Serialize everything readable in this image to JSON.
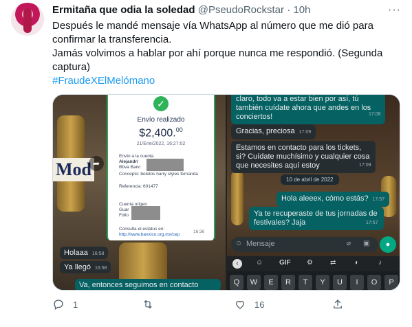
{
  "author": {
    "name": "Ermitaña que odia la soledad",
    "handle": "@PseudoRockstar",
    "separator": "·",
    "time": "10h"
  },
  "tweet": {
    "line1": "Después le mandé mensaje vía WhatsApp al número que me dió para confirmar la transferencia.",
    "line2": "Jamás volvimos a hablar por ahí porque nunca me respondió. (Segunda captura)",
    "hashtag": "#FraudeXElMelómano"
  },
  "media_left": {
    "receipt": {
      "title": "Envío realizado",
      "amount": "$2,400.",
      "amount_cents": "00",
      "date": "21/Ene/2022, 16:27:02",
      "sent_to_label": "Envío a la cuenta",
      "recipient": "Alejandri",
      "bank": "Bbva Banc",
      "concept": "Concepto: boletos harry styles fernanda",
      "reference": "Referencia: 601477",
      "origin_label": "Cuenta origen",
      "origin_line1": "Guar",
      "origin_line2": "Folio",
      "status_link_label": "Consulta el estatus en:",
      "status_link": "http://www.banxico.org.mx/cep",
      "time": "16:36"
    },
    "beer_label": "Mod",
    "messages": [
      {
        "text": "Holaaa",
        "time": "16:58"
      },
      {
        "text": "Ya llegó",
        "time": "16:58"
      },
      {
        "text": "Va, entonces seguimos en contacto"
      }
    ]
  },
  "media_right": {
    "messages": [
      {
        "text": "claro, todo va a estar bien por así, tú también cuídate ahora que andes en los conciertos!",
        "time": "17:08"
      },
      {
        "text": "Gracias, preciosa",
        "time": "17:09"
      },
      {
        "text": "Estamos en contacto para los tickets, si? Cuídate muchísimo y cualquier cosa que necesites aquí estoy",
        "time": "17:09"
      },
      {
        "text": "Hola aleeex, cómo estás?",
        "time": "17:57"
      },
      {
        "text": "Ya te recuperaste de tus jornadas de festivales? Jaja",
        "time": "17:57"
      }
    ],
    "date_pill": "10 de abril de 2022",
    "input_placeholder": "Mensaje",
    "keyboard": {
      "gif": "GIF",
      "keys": [
        "Q",
        "W",
        "E",
        "R",
        "T",
        "Y",
        "U",
        "I",
        "O",
        "P"
      ]
    }
  },
  "actions": {
    "reply_count": "1",
    "retweet_count": "",
    "like_count": "16"
  },
  "colors": {
    "link": "#1d9bf0",
    "secondary": "#536471",
    "wa_out": "#056162",
    "wa_in": "#262d31"
  }
}
